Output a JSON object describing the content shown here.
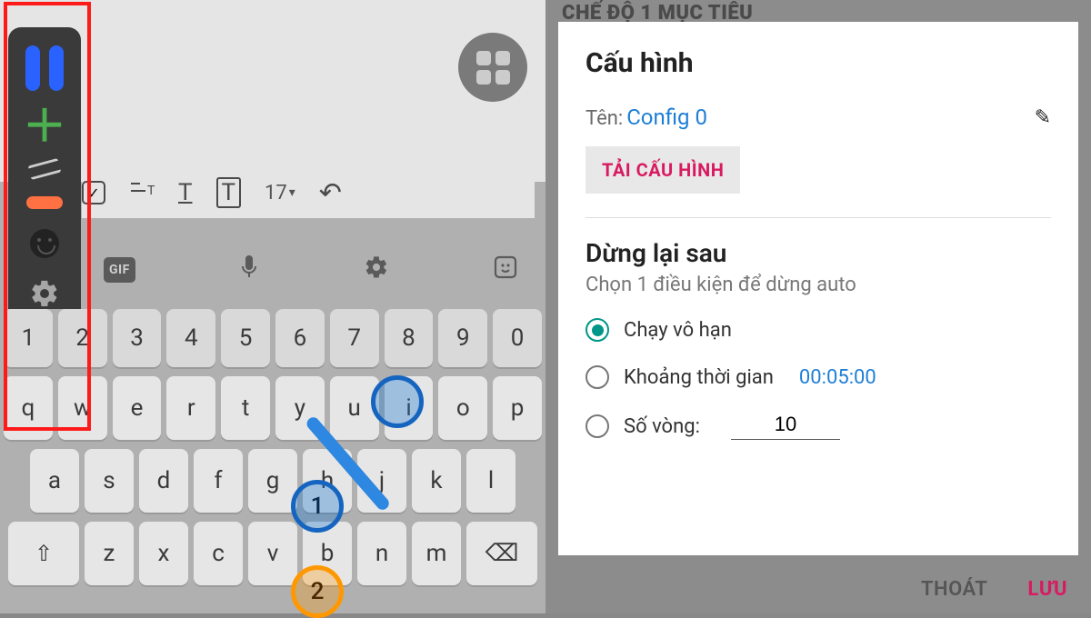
{
  "left": {
    "editor_toolbar": {
      "font_size": "17",
      "undo": "↶"
    },
    "keyboard": {
      "gif": "GIF",
      "num_row": [
        "1",
        "2",
        "3",
        "4",
        "5",
        "6",
        "7",
        "8",
        "9",
        "0"
      ],
      "row1": [
        "q",
        "w",
        "e",
        "r",
        "t",
        "y",
        "u",
        "i",
        "o",
        "p"
      ],
      "row2": [
        "a",
        "s",
        "d",
        "f",
        "g",
        "h",
        "j",
        "k",
        "l"
      ],
      "row3_shift": "⇧",
      "row3": [
        "z",
        "x",
        "c",
        "v",
        "b",
        "n",
        "m"
      ],
      "backspace": "⌫"
    },
    "swipe": {
      "label1": "1",
      "label2": "2"
    }
  },
  "right": {
    "dim_header": "CHẾ ĐỘ 1 MỤC TIÊU",
    "title": "Cấu hình",
    "name_label": "Tên:",
    "name_value": "Config 0",
    "load_config": "TẢI CẤU HÌNH",
    "stop_title": "Dừng lại sau",
    "stop_sub": "Chọn 1 điều kiện để dừng auto",
    "opt_infinite": "Chạy vô hạn",
    "opt_interval": "Khoảng thời gian",
    "interval_value": "00:05:00",
    "opt_loops": "Số vòng:",
    "loops_value": "10",
    "exit": "THOÁT",
    "save": "LƯU"
  }
}
